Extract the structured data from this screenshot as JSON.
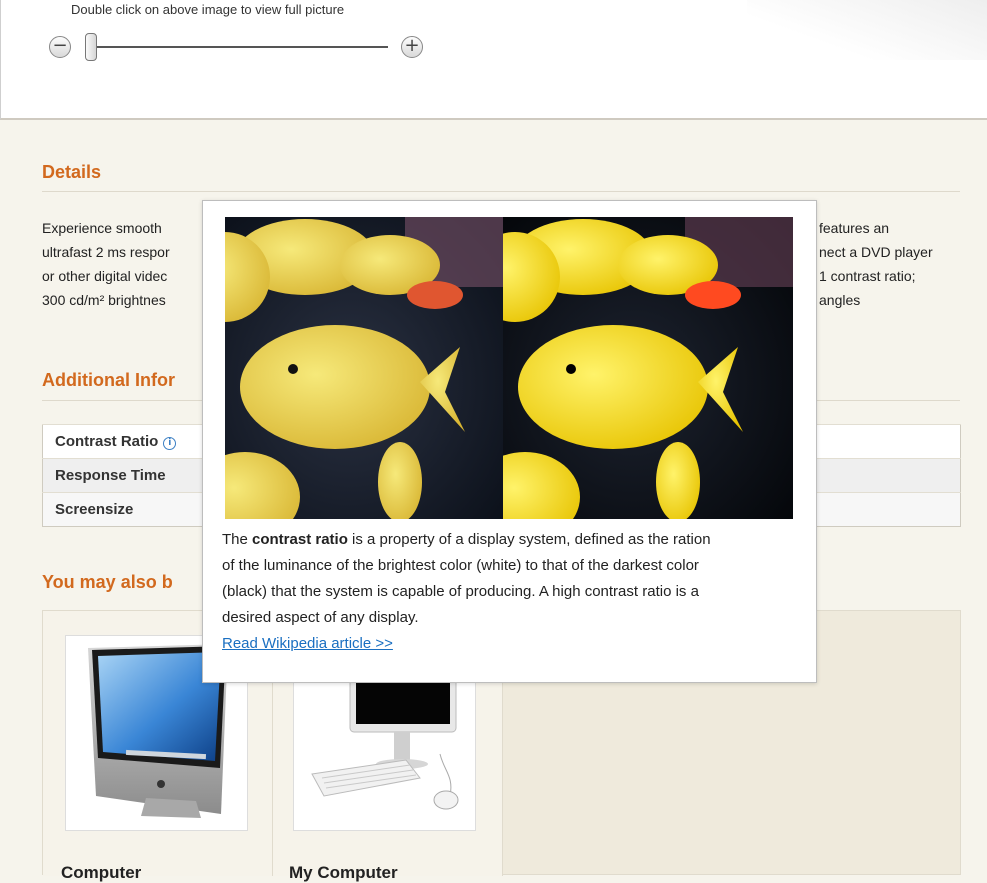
{
  "zoom": {
    "hint": "Double click on above image to view full picture",
    "minus": "−",
    "plus": "+",
    "level": 0.0
  },
  "details": {
    "heading": "Details",
    "lines": [
      "Experience smooth",
      "ultrafast 2 ms respor",
      "or other digital videc",
      "300 cd/m² brightnes"
    ],
    "right_lines": [
      "features an",
      "nect a DVD player",
      "1 contrast ratio;",
      "angles"
    ]
  },
  "additional": {
    "heading": "Additional Infor",
    "rows": [
      {
        "label": "Contrast Ratio",
        "info_icon": "info-icon"
      },
      {
        "label": "Response Time"
      },
      {
        "label": "Screensize"
      }
    ]
  },
  "upsell": {
    "heading": "You may also b",
    "products": [
      {
        "name": "Computer",
        "image": "imac-computer"
      },
      {
        "name": "My Computer",
        "image": "desktop-computer-with-keyboard-mouse"
      }
    ]
  },
  "tooltip": {
    "image": "fish-contrast-comparison",
    "line1_pre": "The ",
    "line1_bold": "contrast ratio",
    "line1_post": " is a property of a display system, defined as the ration",
    "line2": "of the luminance of the brightest color (white) to that of the darkest color",
    "line3": "(black) that the system is capable of producing. A high contrast ratio is a",
    "line4": "desired aspect of any display.",
    "link": "Read Wikipedia article >>"
  },
  "colors": {
    "heading": "#d2691e",
    "link": "#1a6fc1",
    "page_bg": "#f6f4ec"
  }
}
